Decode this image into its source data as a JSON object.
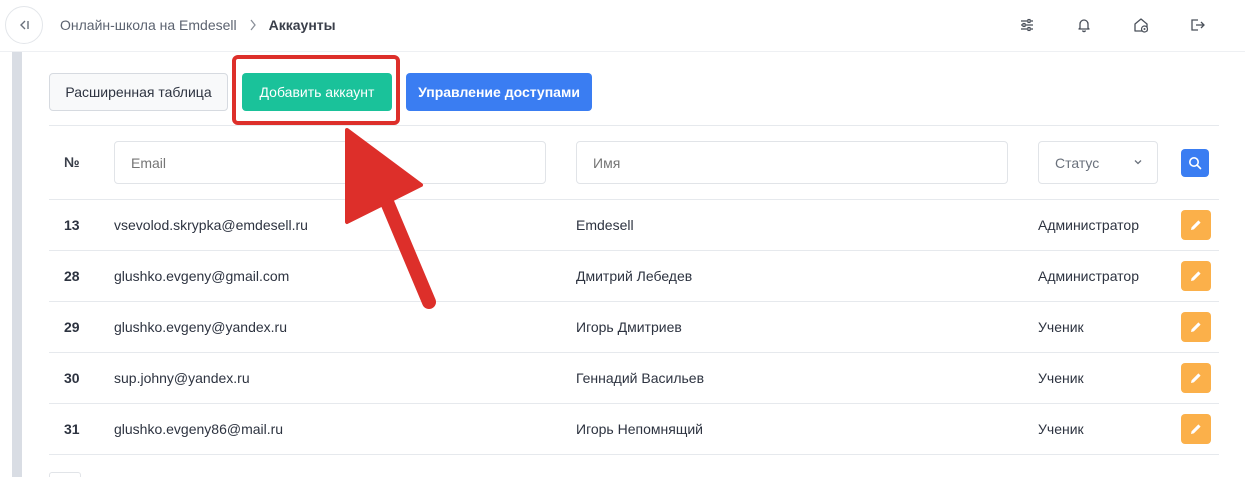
{
  "breadcrumb": {
    "parent": "Онлайн-школа на Emdesell",
    "current": "Аккаунты"
  },
  "header_icons": [
    "sliders-icon",
    "bell-icon",
    "home-settings-icon",
    "logout-icon"
  ],
  "toolbar": {
    "extended_table_label": "Расширенная таблица",
    "add_account_label": "Добавить аккаунт",
    "access_management_label": "Управление доступами"
  },
  "filters": {
    "num_header": "№",
    "email_placeholder": "Email",
    "name_placeholder": "Имя",
    "status_value": "Статус"
  },
  "rows": [
    {
      "num": "13",
      "email": "vsevolod.skrypka@emdesell.ru",
      "name": "Emdesell",
      "status": "Администратор"
    },
    {
      "num": "28",
      "email": "glushko.evgeny@gmail.com",
      "name": "Дмитрий Лебедев",
      "status": "Администратор"
    },
    {
      "num": "29",
      "email": "glushko.evgeny@yandex.ru",
      "name": "Игорь Дмитриев",
      "status": "Ученик"
    },
    {
      "num": "30",
      "email": "sup.johny@yandex.ru",
      "name": "Геннадий Васильев",
      "status": "Ученик"
    },
    {
      "num": "31",
      "email": "glushko.evgeny86@mail.ru",
      "name": "Игорь Непомнящий",
      "status": "Ученик"
    }
  ],
  "colors": {
    "add_button": "#1ac29a",
    "access_button": "#3a7df2",
    "edit_button": "#fbb04a",
    "annotation_red": "#dd2f2a"
  }
}
